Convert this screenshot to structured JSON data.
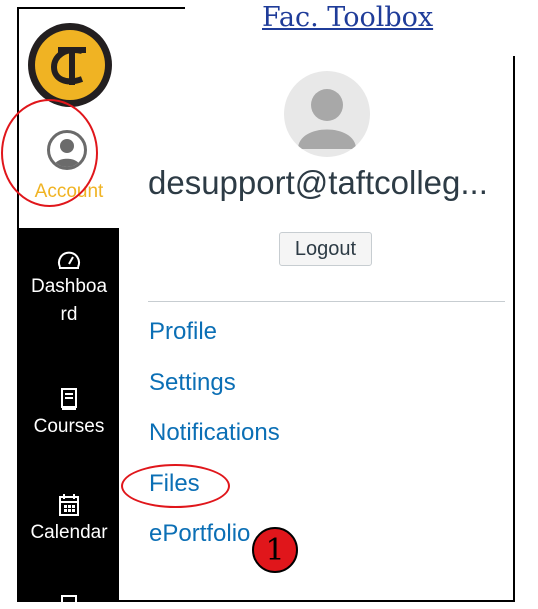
{
  "header": {
    "title": "Fac. Toolbox"
  },
  "logo": {
    "glyph": "T",
    "glyph2": "C"
  },
  "sidebar": {
    "account_label": "Account",
    "items": [
      {
        "label_line1": "Dashboa",
        "label_line2": "rd",
        "icon": "dashboard-icon"
      },
      {
        "label_line1": "Courses",
        "icon": "courses-icon"
      },
      {
        "label_line1": "Calendar",
        "icon": "calendar-icon"
      }
    ]
  },
  "tray": {
    "user_email": "desupport@taftcolleg...",
    "logout_label": "Logout",
    "links": [
      "Profile",
      "Settings",
      "Notifications",
      "Files",
      "ePortfolio"
    ]
  },
  "annotation": {
    "step_number": "1"
  },
  "colors": {
    "brand_gold": "#f0b323",
    "link_blue": "#0b6fb5",
    "highlight_red": "#e0161b",
    "title_blue": "#1f3c99"
  }
}
